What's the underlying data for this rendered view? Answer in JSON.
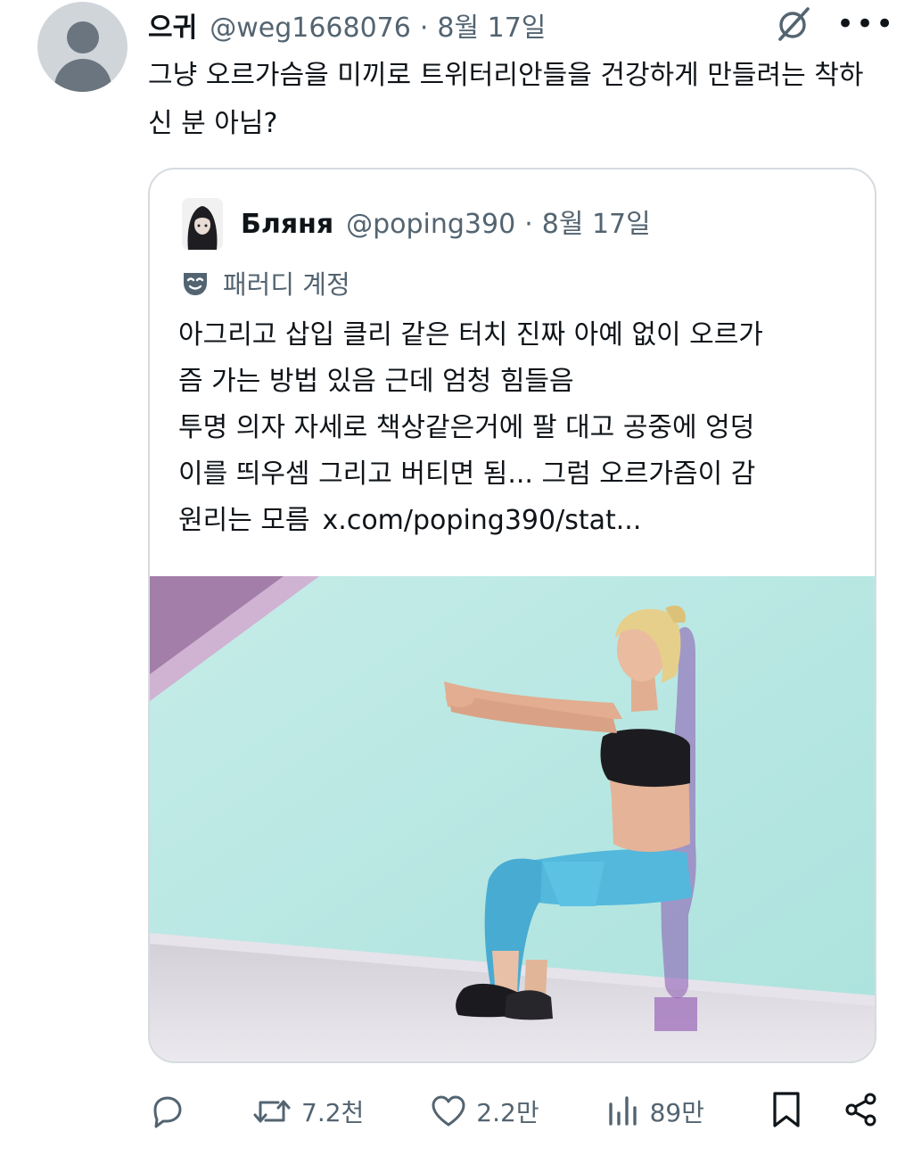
{
  "tweet": {
    "display_name": "으귀",
    "handle": "@weg1668076",
    "separator": "·",
    "date": "8월 17일",
    "text": "그냥 오르가슴을 미끼로 트위터리안들을 건강하게 만들려는 착하신 분 아님?"
  },
  "quote": {
    "display_name": "Бляня",
    "handle": "@poping390",
    "separator": "·",
    "date": "8월 17일",
    "parody_label": "패러디 계정",
    "text_lines": [
      "아그리고 삽입 클리 같은 터치 진짜 아예 없이 오르가",
      "즘 가는 방법 있음 근데 엄청 힘들음",
      "투명 의자 자세로 책상같은거에 팔 대고 공중에 엉덩",
      "이를 띄우셈 그리고 버티면 됨... 그럼 오르가즘이 감"
    ],
    "last_line": "원리는 모름",
    "link": "x.com/poping390/stat..."
  },
  "actions": {
    "retweets": "7.2천",
    "likes": "2.2만",
    "views": "89만"
  },
  "icons": {
    "reply": "reply-icon",
    "retweet": "retweet-icon",
    "like": "heart-icon",
    "views": "views-icon",
    "bookmark": "bookmark-icon",
    "share": "share-icon",
    "grok": "grok-icon",
    "more": "more-icon",
    "parody": "mask-icon"
  },
  "colors": {
    "text_primary": "#0f1419",
    "text_secondary": "#536471",
    "border": "#d6dbe0",
    "photo_background": "#b7e6e2"
  }
}
